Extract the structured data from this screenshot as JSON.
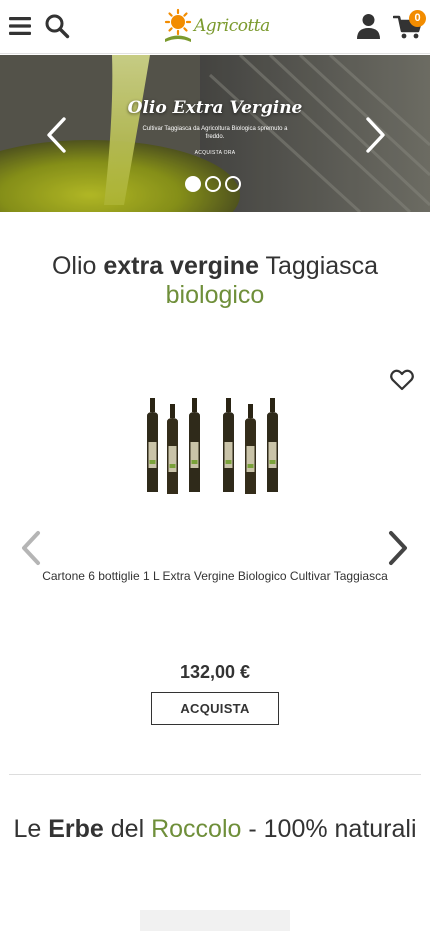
{
  "header": {
    "logo_text": "Agricotta",
    "cart_count": "0",
    "icons": [
      "menu-icon",
      "search-icon",
      "user-icon",
      "cart-icon"
    ],
    "colors": {
      "brand_green": "#7b9a2e",
      "sun_orange": "#f28c00"
    }
  },
  "hero": {
    "title": "Olio Extra Vergine",
    "subtitle": "Cultivar Taggiasca da Agricoltura Biologica spremuto a freddo.",
    "cta": "ACQUISTA ORA",
    "slides": 3,
    "active_slide": 1
  },
  "section1": {
    "title_pre": "Olio ",
    "title_bold": "extra vergine",
    "title_post": " Taggiasca",
    "title_green": "biologico"
  },
  "product": {
    "name": "Cartone 6 bottiglie 1 L Extra Vergine Biologico Cultivar Taggiasca",
    "price": "132,00 €",
    "buy_label": "ACQUISTA"
  },
  "section2": {
    "title_pre": "Le ",
    "title_bold": "Erbe",
    "title_mid": " del ",
    "title_green": "Roccolo",
    "title_post": " - 100% naturali"
  },
  "colors": {
    "accent_green": "#6f8f3a",
    "text": "#333333",
    "divider": "#dddddd"
  }
}
